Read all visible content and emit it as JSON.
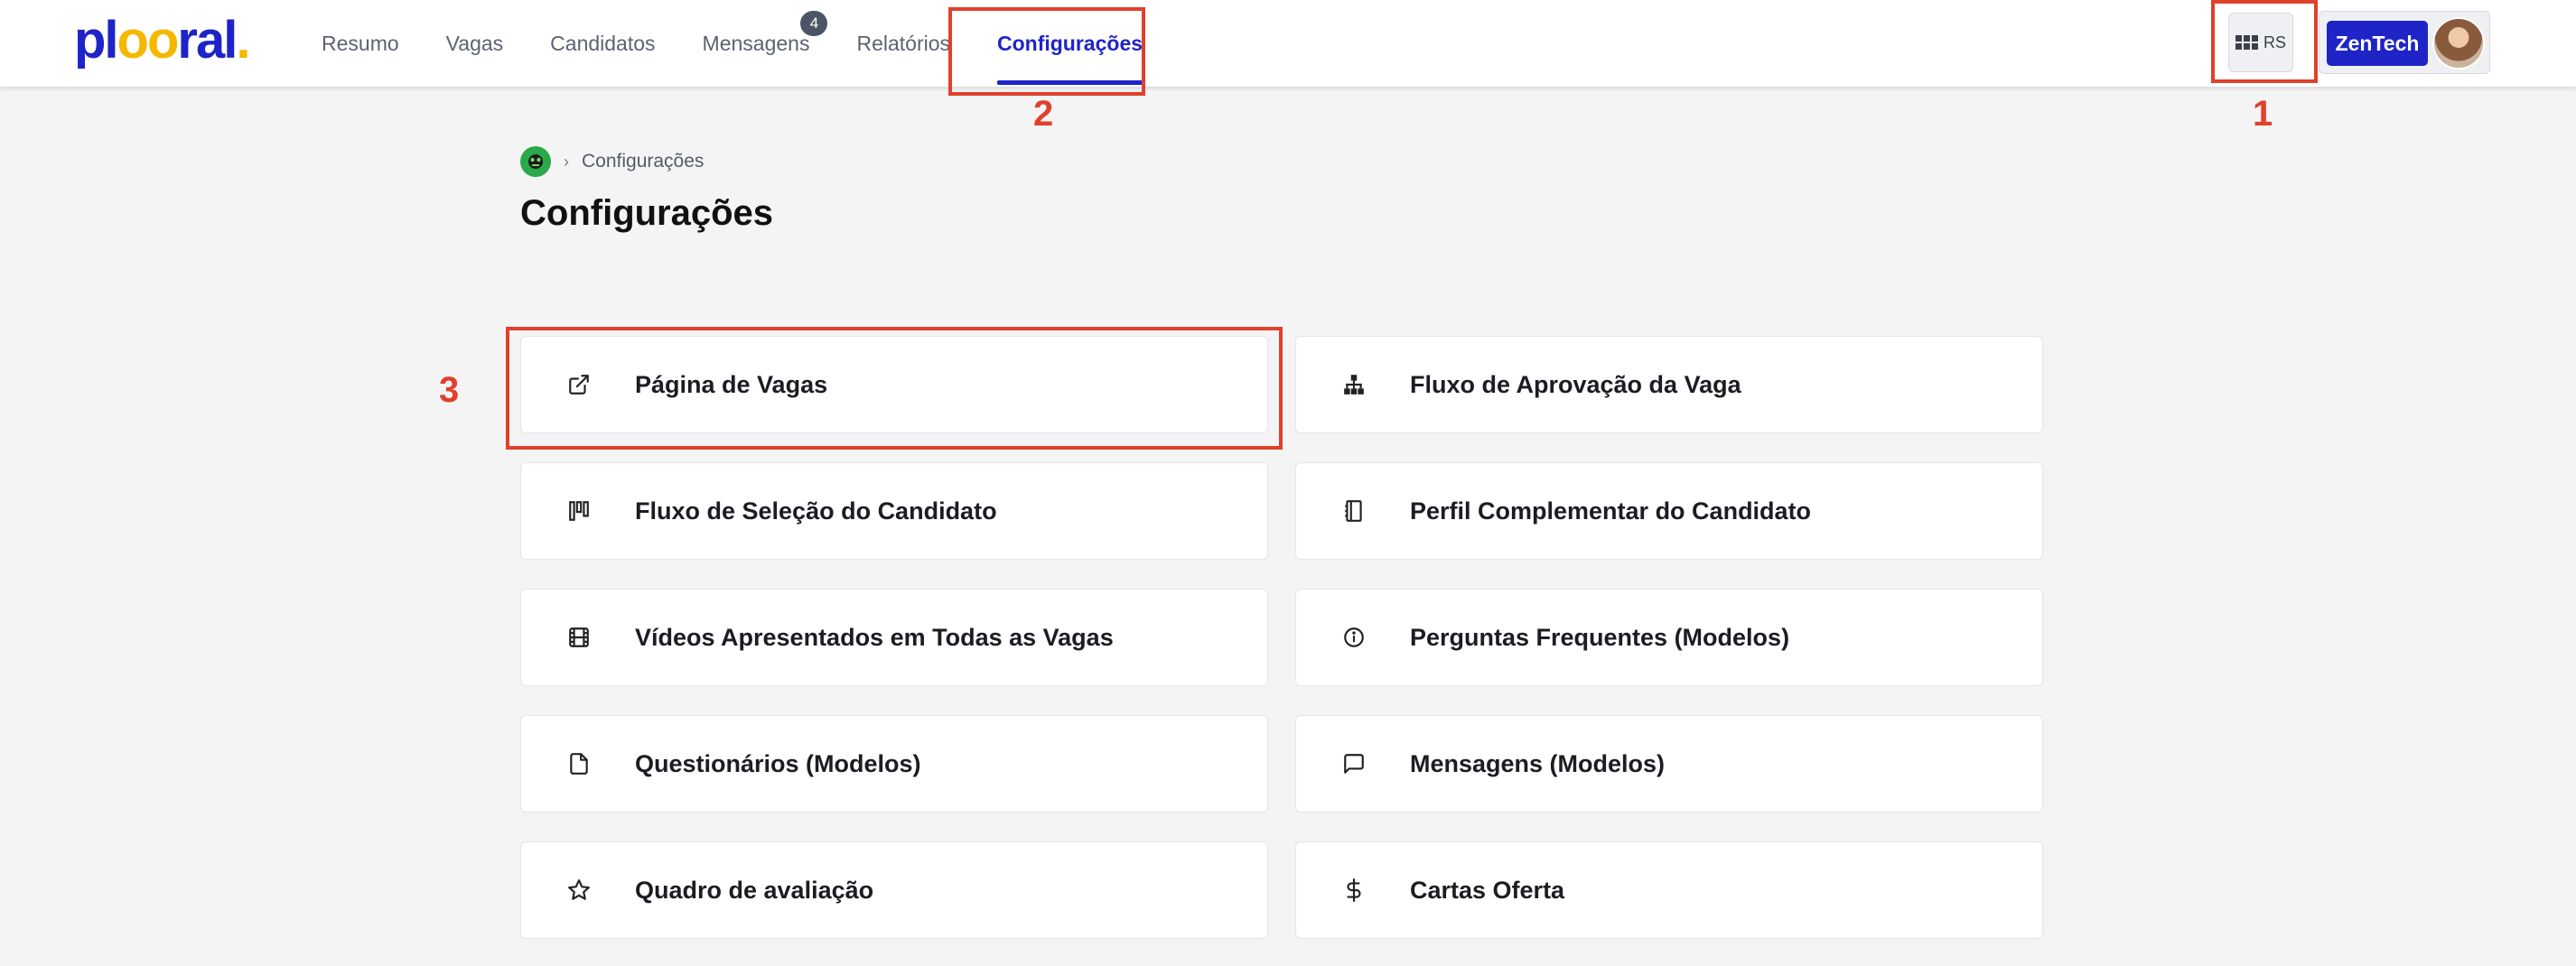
{
  "app": {
    "logo": "plooral"
  },
  "nav": {
    "items": [
      {
        "label": "Resumo",
        "key": "resumo"
      },
      {
        "label": "Vagas",
        "key": "vagas"
      },
      {
        "label": "Candidatos",
        "key": "candidatos"
      },
      {
        "label": "Mensagens",
        "key": "mensagens",
        "badge": "4"
      },
      {
        "label": "Relatórios",
        "key": "relatorios"
      },
      {
        "label": "Configurações",
        "key": "configuracoes",
        "active": true
      }
    ]
  },
  "header": {
    "apps_label": "RS",
    "company": "ZenTech"
  },
  "annotations": [
    "1",
    "2",
    "3"
  ],
  "breadcrumb": {
    "current": "Configurações"
  },
  "page": {
    "title": "Configurações"
  },
  "cards": [
    {
      "label": "Página de Vagas",
      "icon": "external-link-icon"
    },
    {
      "label": "Fluxo de Aprovação da Vaga",
      "icon": "hierarchy-icon"
    },
    {
      "label": "Fluxo de Seleção do Candidato",
      "icon": "kanban-icon"
    },
    {
      "label": "Perfil Complementar do Candidato",
      "icon": "notebook-icon"
    },
    {
      "label": "Vídeos Apresentados em Todas as Vagas",
      "icon": "film-icon"
    },
    {
      "label": "Perguntas Frequentes (Modelos)",
      "icon": "info-icon"
    },
    {
      "label": "Questionários (Modelos)",
      "icon": "file-icon"
    },
    {
      "label": "Mensagens (Modelos)",
      "icon": "chat-icon"
    },
    {
      "label": "Quadro de avaliação",
      "icon": "star-icon"
    },
    {
      "label": "Cartas Oferta",
      "icon": "dollar-icon"
    }
  ],
  "colors": {
    "brand": "#1f24c7",
    "accent": "#f5b800",
    "annotation": "#e0402c"
  }
}
